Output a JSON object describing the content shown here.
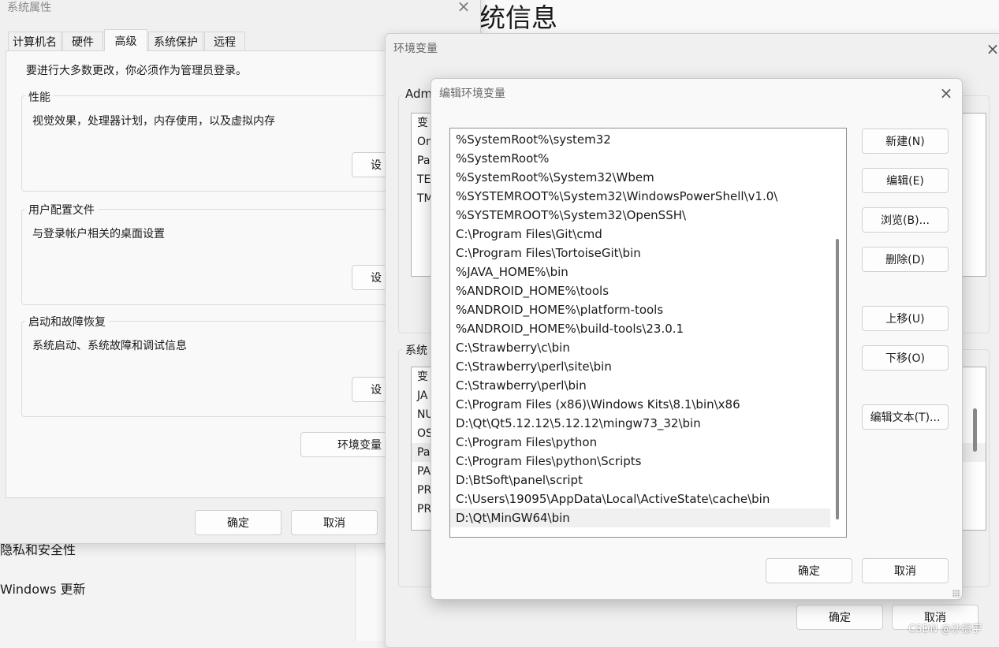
{
  "bg_settings": {
    "header_partial": "统信息",
    "nav_privacy": "隐私和安全性",
    "nav_update": "Windows 更新"
  },
  "sys_props": {
    "title": "系统属性",
    "tabs": [
      "计算机名",
      "硬件",
      "高级",
      "系统保护",
      "远程"
    ],
    "admin_note": "要进行大多数更改，你必须作为管理员登录。",
    "perf_title": "性能",
    "perf_desc": "视觉效果，处理器计划，内存使用，以及虚拟内存",
    "profile_title": "用户配置文件",
    "profile_desc": "与登录帐户相关的桌面设置",
    "startup_title": "启动和故障恢复",
    "startup_desc": "系统启动、系统故障和调试信息",
    "settings_btn_partial": "设",
    "env_btn": "环境变量",
    "ok": "确定",
    "cancel": "取消"
  },
  "env_vars": {
    "title": "环境变量",
    "user_group_partial": "Adm",
    "user_rows": [
      "变",
      "On",
      "Pa",
      "TE",
      "TM"
    ],
    "sys_group_partial": "系统",
    "sys_rows": [
      "变",
      "JA",
      "NU",
      "OS",
      "Pa",
      "PA",
      "PR",
      "PR"
    ],
    "ok": "确定",
    "cancel": "取消"
  },
  "edit_env": {
    "title": "编辑环境变量",
    "paths": [
      "%SystemRoot%\\system32",
      "%SystemRoot%",
      "%SystemRoot%\\System32\\Wbem",
      "%SYSTEMROOT%\\System32\\WindowsPowerShell\\v1.0\\",
      "%SYSTEMROOT%\\System32\\OpenSSH\\",
      "C:\\Program Files\\Git\\cmd",
      "C:\\Program Files\\TortoiseGit\\bin",
      "%JAVA_HOME%\\bin",
      "%ANDROID_HOME%\\tools",
      "%ANDROID_HOME%\\platform-tools",
      "%ANDROID_HOME%\\build-tools\\23.0.1",
      "C:\\Strawberry\\c\\bin",
      "C:\\Strawberry\\perl\\site\\bin",
      "C:\\Strawberry\\perl\\bin",
      "C:\\Program Files (x86)\\Windows Kits\\8.1\\bin\\x86",
      "D:\\Qt\\Qt5.12.12\\5.12.12\\mingw73_32\\bin",
      "C:\\Program Files\\python",
      "C:\\Program Files\\python\\Scripts",
      "D:\\BtSoft\\panel\\script",
      "C:\\Users\\19095\\AppData\\Local\\ActiveState\\cache\\bin",
      "D:\\Qt\\MinGW64\\bin"
    ],
    "buttons": {
      "new": "新建(N)",
      "edit": "编辑(E)",
      "browse": "浏览(B)...",
      "delete": "删除(D)",
      "move_up": "上移(U)",
      "move_down": "下移(O)",
      "edit_text": "编辑文本(T)..."
    },
    "ok": "确定",
    "cancel": "取消"
  },
  "icons": {
    "close": "×"
  },
  "watermark": "CSDN @沙振宇"
}
